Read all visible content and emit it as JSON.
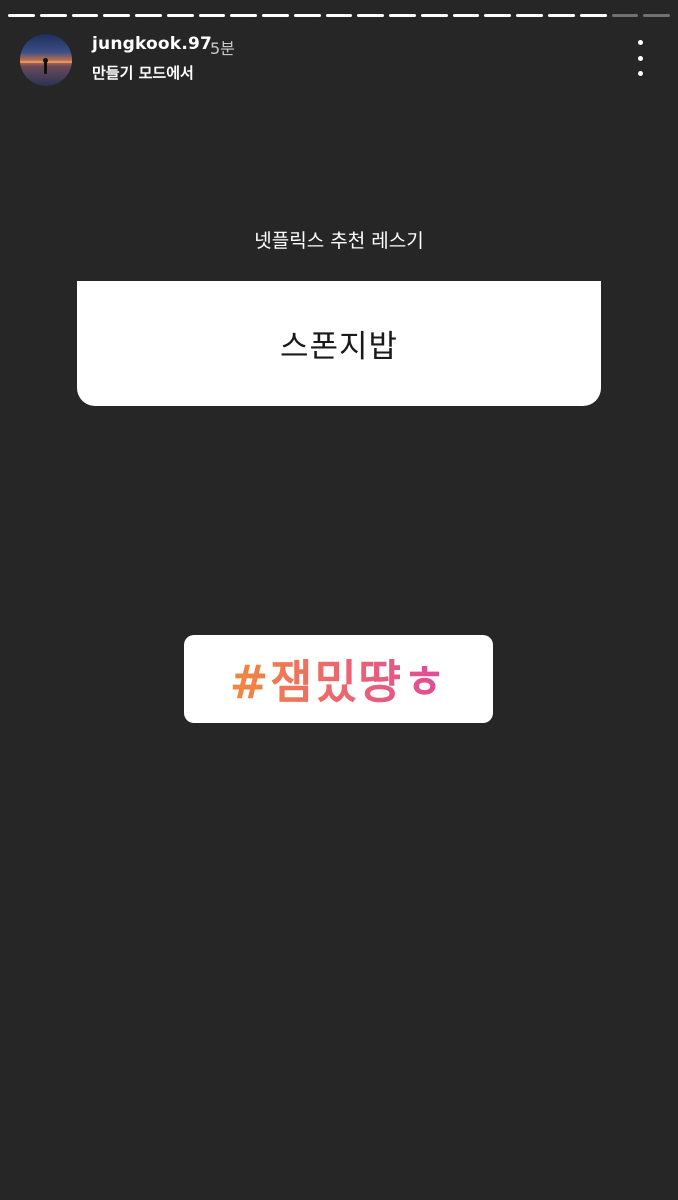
{
  "story": {
    "progress_total": 21,
    "progress_seen": 19
  },
  "header": {
    "username": "jungkook.97",
    "time": "5분",
    "subtitle": "만들기 모드에서",
    "avatar_icon": "sunset-photo-avatar",
    "more_icon": "more-vertical-icon"
  },
  "question_sticker": {
    "question": "넷플릭스 추천 레스기",
    "answer": "스폰지밥"
  },
  "hashtag_sticker": {
    "text": "#잼밌땽ㅎ",
    "gradient_start": "#f08a3c",
    "gradient_end": "#e04a9a"
  },
  "colors": {
    "background": "#262626",
    "sticker_background": "#ffffff"
  }
}
